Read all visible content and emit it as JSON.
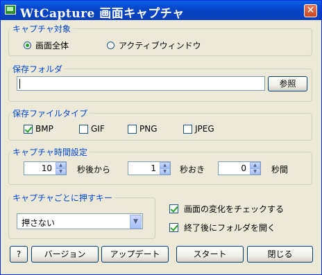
{
  "window": {
    "title": "WtCapture 画面キャプチャ",
    "close_glyph": "✕"
  },
  "target_group": {
    "legend": "キャプチャ対象",
    "fullscreen_label": "画面全体",
    "active_window_label": "アクティブウィンドウ",
    "selected": "画面全体"
  },
  "folder_group": {
    "legend": "保存フォルダ",
    "path_value": "",
    "browse_label": "参照"
  },
  "filetype_group": {
    "legend": "保存ファイルタイプ",
    "options": [
      {
        "label": "BMP",
        "checked": true
      },
      {
        "label": "GIF",
        "checked": false
      },
      {
        "label": "PNG",
        "checked": false
      },
      {
        "label": "JPEG",
        "checked": false
      }
    ]
  },
  "timing_group": {
    "legend": "キャプチャ時間設定",
    "delay_value": "10",
    "delay_label": "秒後から",
    "interval_value": "1",
    "interval_label": "秒おき",
    "count_value": "0",
    "count_label": "秒間"
  },
  "key_group": {
    "legend": "キャプチャごとに押すキー",
    "selected": "押さない"
  },
  "options": {
    "check_changes": {
      "label": "画面の変化をチェックする",
      "checked": true
    },
    "open_folder": {
      "label": "終了後にフォルダを開く",
      "checked": true
    }
  },
  "buttons": {
    "help": "?",
    "version": "バージョン",
    "update": "アップデート",
    "start": "スタート",
    "close": "閉じる"
  }
}
